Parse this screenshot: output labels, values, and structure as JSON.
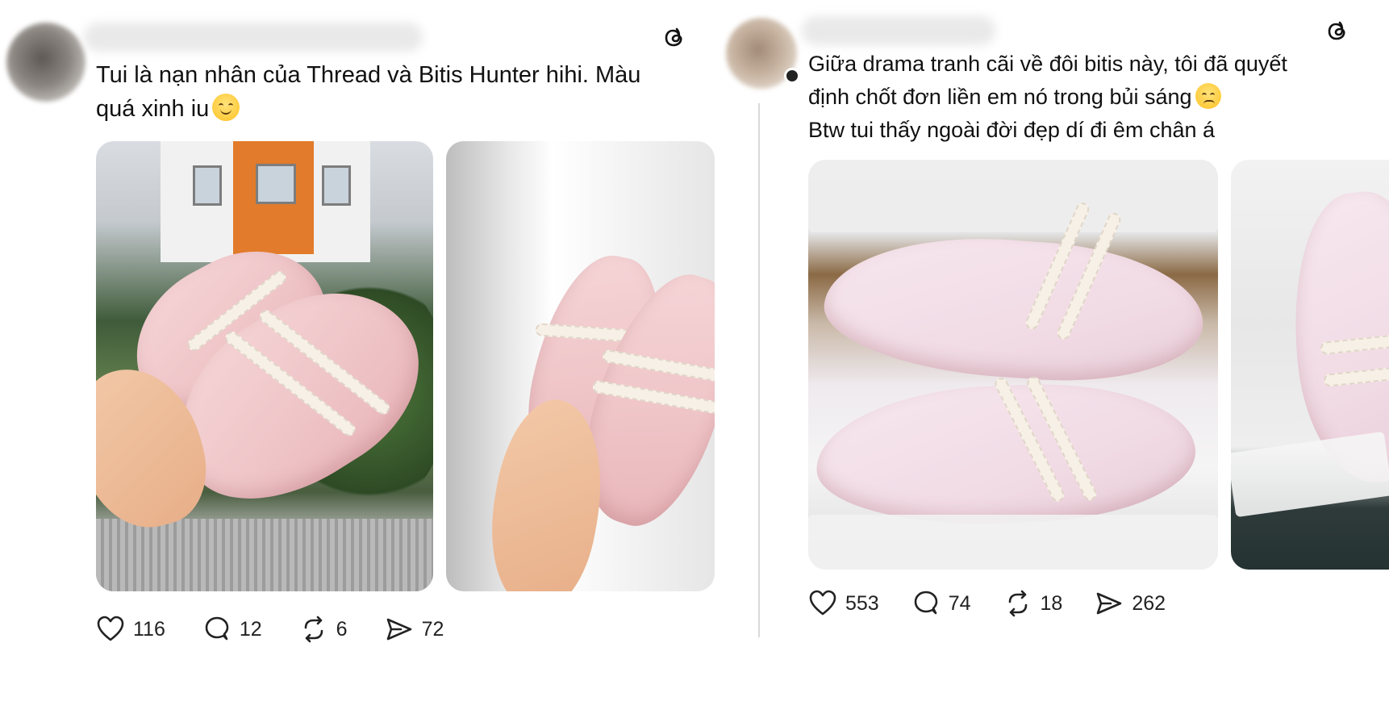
{
  "posts": [
    {
      "caption_line1": "Tui là nạn nhân của Thread và Bitis Hunter hihi. Màu",
      "caption_line2": "quá xinh iu",
      "emoji": "smiling-face-emoji",
      "images": [
        "shoes-held-outdoors-photo",
        "shoes-held-by-curtain-photo"
      ],
      "stats": {
        "likes": "116",
        "comments": "12",
        "reposts": "6",
        "shares": "72"
      }
    },
    {
      "caption_line1": "Giữa drama tranh cãi về đôi bitis này, tôi đã quyết",
      "caption_line2": "định chốt đơn liền em nó trong bủi sáng",
      "caption_line3": "Btw tui thấy ngoài đời đẹp dí đi êm chân á",
      "emoji": "pleading-face-emoji",
      "images": [
        "shoes-in-box-photo",
        "shoes-partial-photo"
      ],
      "stats": {
        "likes": "553",
        "comments": "74",
        "reposts": "18",
        "shares": "262"
      }
    }
  ],
  "icons": {
    "brand": "threads-logo-icon",
    "like": "heart-icon",
    "comment": "comment-bubble-icon",
    "repost": "repost-icon",
    "share": "send-icon"
  },
  "colors": {
    "text": "#111111",
    "divider": "#d9d9d9",
    "shoe_pink": "#efc5c8"
  }
}
